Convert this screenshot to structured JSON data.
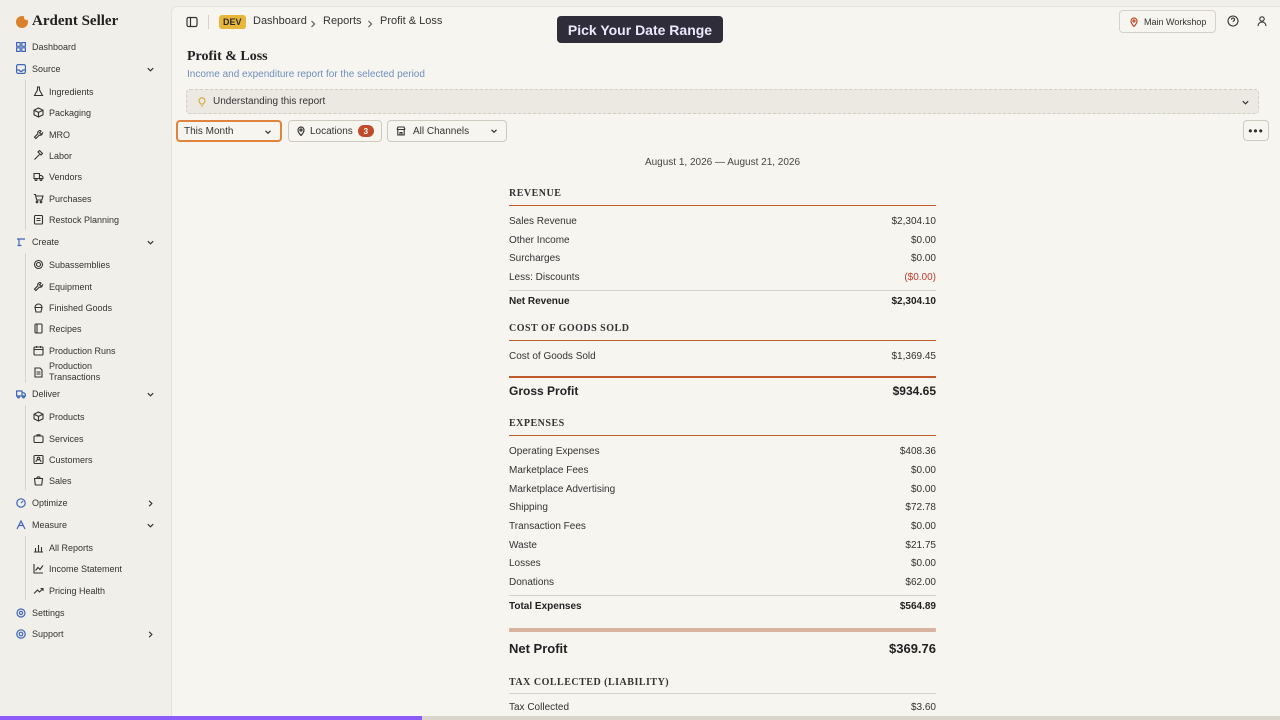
{
  "brand": {
    "name": "Ardent Seller"
  },
  "sidebar": {
    "dashboard": "Dashboard",
    "source": {
      "label": "Source",
      "items": [
        "Ingredients",
        "Packaging",
        "MRO",
        "Labor",
        "Vendors",
        "Purchases",
        "Restock Planning"
      ]
    },
    "create": {
      "label": "Create",
      "items": [
        "Subassemblies",
        "Equipment",
        "Finished Goods",
        "Recipes",
        "Production Runs",
        "Production Transactions"
      ]
    },
    "deliver": {
      "label": "Deliver",
      "items": [
        "Products",
        "Services",
        "Customers",
        "Sales"
      ]
    },
    "optimize": "Optimize",
    "measure": {
      "label": "Measure",
      "items": [
        "All Reports",
        "Income Statement",
        "Pricing Health"
      ]
    },
    "settings": "Settings",
    "support": "Support"
  },
  "topbar": {
    "env_badge": "DEV",
    "breadcrumbs": [
      "Dashboard",
      "Reports",
      "Profit & Loss"
    ],
    "toast": "Pick Your Date Range",
    "workshop": "Main Workshop"
  },
  "page": {
    "title": "Profit & Loss",
    "subtitle": "Income and expenditure report for the selected period",
    "understanding": "Understanding this report"
  },
  "filters": {
    "date_range": "This Month",
    "locations_label": "Locations",
    "locations_count": "3",
    "channels": "All Channels"
  },
  "report": {
    "period": "August 1, 2026 — August 21, 2026",
    "revenue": {
      "heading": "REVENUE",
      "rows": [
        {
          "label": "Sales Revenue",
          "value": "$2,304.10"
        },
        {
          "label": "Other Income",
          "value": "$0.00"
        },
        {
          "label": "Surcharges",
          "value": "$0.00"
        },
        {
          "label": "Less: Discounts",
          "value": "($0.00)"
        }
      ],
      "total_label": "Net Revenue",
      "total_value": "$2,304.10"
    },
    "cogs": {
      "heading": "COST OF GOODS SOLD",
      "rows": [
        {
          "label": "Cost of Goods Sold",
          "value": "$1,369.45"
        }
      ]
    },
    "gross_profit": {
      "label": "Gross Profit",
      "value": "$934.65"
    },
    "expenses": {
      "heading": "EXPENSES",
      "rows": [
        {
          "label": "Operating Expenses",
          "value": "$408.36"
        },
        {
          "label": "Marketplace Fees",
          "value": "$0.00"
        },
        {
          "label": "Marketplace Advertising",
          "value": "$0.00"
        },
        {
          "label": "Shipping",
          "value": "$72.78"
        },
        {
          "label": "Transaction Fees",
          "value": "$0.00"
        },
        {
          "label": "Waste",
          "value": "$21.75"
        },
        {
          "label": "Losses",
          "value": "$0.00"
        },
        {
          "label": "Donations",
          "value": "$62.00"
        }
      ],
      "total_label": "Total Expenses",
      "total_value": "$564.89"
    },
    "net_profit": {
      "label": "Net Profit",
      "value": "$369.76"
    },
    "tax": {
      "heading": "TAX COLLECTED (LIABILITY)",
      "rows": [
        {
          "label": "Tax Collected",
          "value": "$3.60"
        }
      ]
    }
  },
  "progress": {
    "fraction": 0.33
  },
  "colors": {
    "accent": "#c05a2a",
    "brand_icon": "#3f66b8",
    "badge": "#e8b63a",
    "negative": "#c03a2a"
  }
}
